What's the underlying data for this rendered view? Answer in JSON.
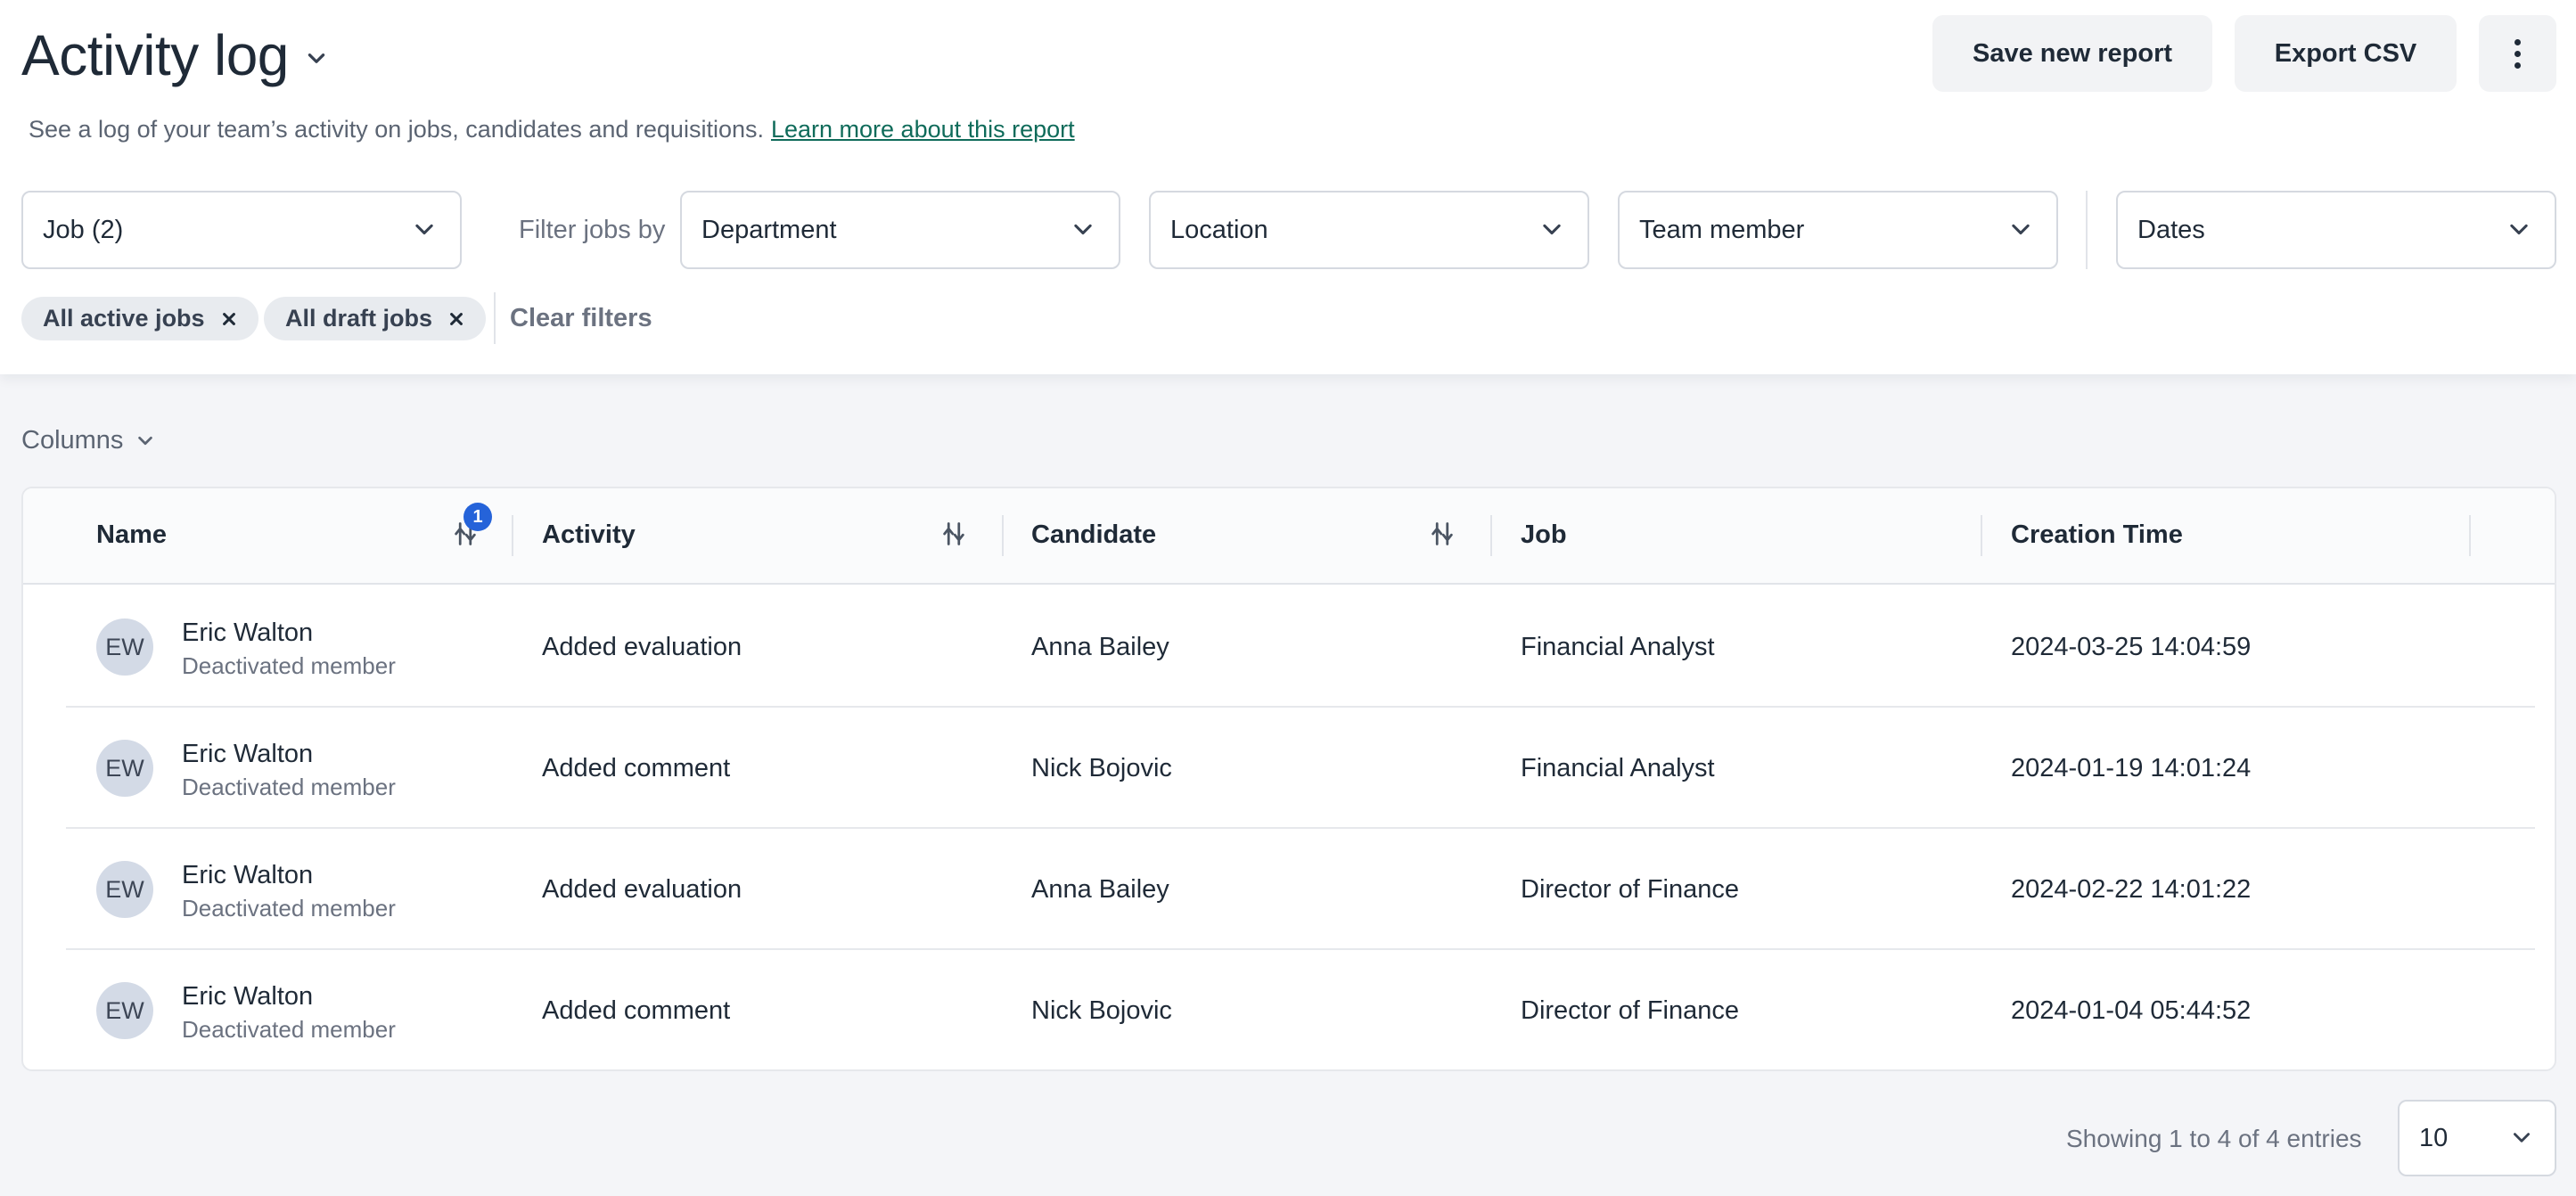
{
  "header": {
    "title": "Activity log",
    "subtitle": "See a log of your team’s activity on jobs, candidates and requisitions.",
    "learn_more": "Learn more about this report",
    "save_label": "Save new report",
    "export_label": "Export CSV",
    "more_icon": "vertical-dots-icon"
  },
  "filters": {
    "job": "Job (2)",
    "filter_jobs_by": "Filter jobs by",
    "department": "Department",
    "location": "Location",
    "team_member": "Team member",
    "dates": "Dates",
    "chips": [
      "All active jobs",
      "All draft jobs"
    ],
    "clear": "Clear filters"
  },
  "columns_toggle": "Columns",
  "table": {
    "headers": [
      "Name",
      "Activity",
      "Candidate",
      "Job",
      "Creation Time"
    ],
    "name_sort_badge": "1",
    "rows": [
      {
        "initials": "EW",
        "name": "Eric Walton",
        "sub": "Deactivated member",
        "activity": "Added evaluation",
        "candidate": "Anna Bailey",
        "job": "Financial Analyst",
        "time": "2024-03-25 14:04:59"
      },
      {
        "initials": "EW",
        "name": "Eric Walton",
        "sub": "Deactivated member",
        "activity": "Added comment",
        "candidate": "Nick Bojovic",
        "job": "Financial Analyst",
        "time": "2024-01-19 14:01:24"
      },
      {
        "initials": "EW",
        "name": "Eric Walton",
        "sub": "Deactivated member",
        "activity": "Added evaluation",
        "candidate": "Anna Bailey",
        "job": "Director of Finance",
        "time": "2024-02-22 14:01:22"
      },
      {
        "initials": "EW",
        "name": "Eric Walton",
        "sub": "Deactivated member",
        "activity": "Added comment",
        "candidate": "Nick Bojovic",
        "job": "Director of Finance",
        "time": "2024-01-04 05:44:52"
      }
    ]
  },
  "footer": {
    "showing": "Showing 1 to 4 of 4 entries",
    "page_size": "10"
  },
  "colors": {
    "accent_link": "#0f6b5a",
    "badge": "#2563d9",
    "avatar_bg": "#d3dae6"
  }
}
